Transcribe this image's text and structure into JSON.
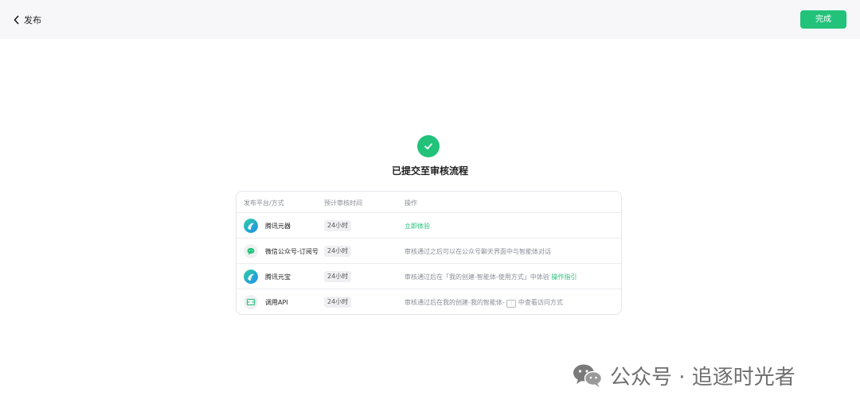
{
  "header": {
    "back_label": "发布",
    "done_label": "完成"
  },
  "status": {
    "title": "已提交至审核流程"
  },
  "table": {
    "columns": [
      "发布平台/方式",
      "预计审核时间",
      "操作"
    ],
    "rows": [
      {
        "platform": "腾讯元器",
        "time": "24小时",
        "op_link": "立即体验"
      },
      {
        "platform": "微信公众号-订阅号",
        "time": "24小时",
        "op_text": "审核通过之后可以在公众号聊天界面中与智能体对话"
      },
      {
        "platform": "腾讯元宝",
        "time": "24小时",
        "op_text": "审核通过后在「我的创建-智能体-使用方式」中体验",
        "op_link": "操作指引"
      },
      {
        "platform": "调用API",
        "time": "24小时",
        "op_text_a": "审核通过后在我的创建-我的智能体-",
        "op_key": "⋮",
        "op_text_b": "中查看访问方式"
      }
    ]
  },
  "watermark": {
    "text": "公众号 · 追逐时光者"
  },
  "colors": {
    "accent": "#22c27a",
    "topbar": "#f7f7fa",
    "border": "#e5e6ea"
  }
}
